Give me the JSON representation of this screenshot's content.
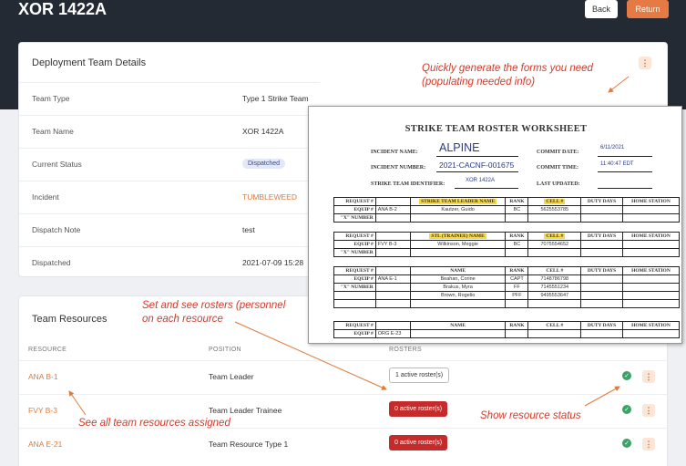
{
  "header": {
    "title": "XOR 1422A",
    "back_label": "Back",
    "return_label": "Return"
  },
  "details": {
    "title": "Deployment Team Details",
    "rows": [
      {
        "label": "Team Type",
        "value": "Type 1 Strike Team"
      },
      {
        "label": "Team Name",
        "value": "XOR 1422A"
      },
      {
        "label": "Current Status",
        "value": "Dispatched"
      },
      {
        "label": "Incident",
        "value": "TUMBLEWEED"
      },
      {
        "label": "Dispatch Note",
        "value": "test"
      },
      {
        "label": "Dispatched",
        "value": "2021-07-09 15:28"
      }
    ]
  },
  "resources": {
    "title": "Team Resources",
    "columns": [
      "RESOURCE",
      "POSITION",
      "ROSTERS"
    ],
    "rows": [
      {
        "name": "ANA B-1",
        "position": "Team Leader",
        "roster": "1 active roster(s)"
      },
      {
        "name": "FVY B-3",
        "position": "Team Leader Trainee",
        "roster": "0 active roster(s)"
      },
      {
        "name": "ANA E-21",
        "position": "Team Resource Type 1",
        "roster": "0 active roster(s)"
      }
    ]
  },
  "annotations": {
    "forms": [
      "Quickly generate the forms you need",
      "(populating needed info)"
    ],
    "rosters": [
      "Set and see rosters (personnel",
      "on each resource"
    ],
    "resources": "See all team resources assigned",
    "status": "Show resource status"
  },
  "worksheet": {
    "title": "STRIKE TEAM ROSTER WORKSHEET",
    "incident_name_label": "INCIDENT NAME:",
    "incident_name": "ALPINE",
    "incident_number_label": "INCIDENT NUMBER:",
    "incident_number": "2021-CACNF-001675",
    "team_id_label": "STRIKE TEAM IDENTIFIER:",
    "team_id": "XOR 1422A",
    "commit_date_label": "COMMIT DATE:",
    "commit_date": "6/11/2021",
    "commit_time_label": "COMMIT TIME:",
    "commit_time": "11:40:47 EDT",
    "last_updated_label": "LAST UPDATED:",
    "labels": {
      "request": "REQUEST #",
      "equip": "EQUIP #",
      "x_number": "\"X\" NUMBER",
      "rank": "RANK",
      "cell": "CELL #",
      "duty_days": "DUTY DAYS",
      "home_station": "HOME STATION",
      "name": "NAME"
    },
    "leader_header": "STRIKE TEAM LEADER NAME",
    "trainee_header": "STL (TRAINEE) NAME",
    "blocks": [
      {
        "equip": "ANA B-2",
        "people": [
          {
            "name": "Kautzer, Guido",
            "rank": "BC",
            "cell": "5625553785"
          }
        ]
      },
      {
        "equip": "FVY B-3",
        "people": [
          {
            "name": "Wilkinson, Meggie",
            "rank": "BC",
            "cell": "7075554652"
          }
        ]
      },
      {
        "equip": "ANA E-1",
        "people": [
          {
            "name": "Beahan, Corine",
            "rank": "CAPT",
            "cell": "7148786798"
          },
          {
            "name": "Brakus, Myra",
            "rank": "FF",
            "cell": "7145551234"
          },
          {
            "name": "Brown, Rogelio",
            "rank": "PFF",
            "cell": "9495553647"
          }
        ]
      },
      {
        "equip": "ORG E-23",
        "people": []
      }
    ]
  },
  "colors": {
    "accent": "#e57a44",
    "header_bg": "#242a33",
    "danger": "#c62b2b",
    "success": "#3aa366",
    "annotation": "#d23a2a"
  }
}
